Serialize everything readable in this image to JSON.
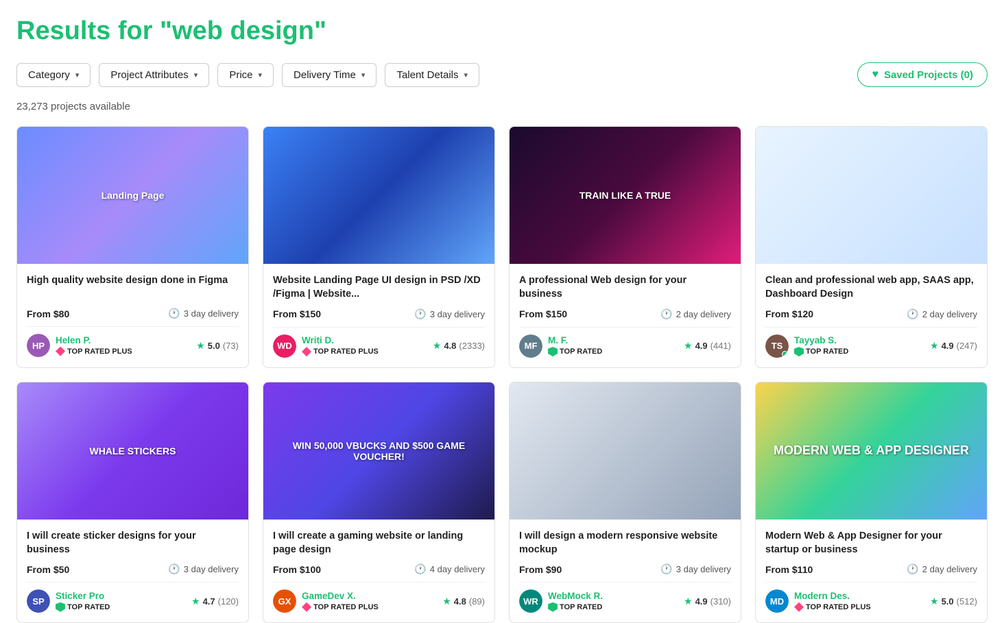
{
  "page": {
    "title": "Results for \"web design\""
  },
  "filters": {
    "category_label": "Category",
    "project_attributes_label": "Project Attributes",
    "price_label": "Price",
    "delivery_time_label": "Delivery Time",
    "talent_details_label": "Talent Details",
    "saved_projects_label": "Saved Projects (0)"
  },
  "results_count": "23,273 projects available",
  "projects": [
    {
      "id": 1,
      "title": "High quality website design done in Figma",
      "from_label": "From",
      "price": "$80",
      "delivery": "3 day delivery",
      "seller_name": "Helen P.",
      "seller_initials": "HP",
      "seller_avatar_color": "#9b59b6",
      "badge_type": "top_rated_plus",
      "badge_label": "TOP RATED PLUS",
      "rating": "5.0",
      "rating_count": "(73)",
      "img_class": "img-landing",
      "img_text": "Landing Page",
      "has_online": false
    },
    {
      "id": 2,
      "title": "Website Landing Page UI design in PSD /XD /Figma | Website...",
      "from_label": "From",
      "price": "$150",
      "delivery": "3 day delivery",
      "seller_name": "Writi D.",
      "seller_initials": "WD",
      "seller_avatar_color": "#e91e63",
      "badge_type": "top_rated_plus",
      "badge_label": "TOP RATED PLUS",
      "rating": "4.8",
      "rating_count": "(2333)",
      "img_class": "img-ui",
      "img_text": "",
      "has_online": false
    },
    {
      "id": 3,
      "title": "A professional Web design for your business",
      "from_label": "From",
      "price": "$150",
      "delivery": "2 day delivery",
      "seller_name": "M. F.",
      "seller_initials": "MF",
      "seller_avatar_color": "#607d8b",
      "badge_type": "top_rated",
      "badge_label": "TOP RATED",
      "rating": "4.9",
      "rating_count": "(441)",
      "img_class": "img-dark",
      "img_text": "TRAIN LIKE A TRUE",
      "has_online": false
    },
    {
      "id": 4,
      "title": "Clean and professional web app, SAAS app, Dashboard Design",
      "from_label": "From",
      "price": "$120",
      "delivery": "2 day delivery",
      "seller_name": "Tayyab S.",
      "seller_initials": "TS",
      "seller_avatar_color": "#795548",
      "badge_type": "top_rated",
      "badge_label": "TOP RATED",
      "rating": "4.9",
      "rating_count": "(247)",
      "img_class": "img-dashboard",
      "img_text": "",
      "has_online": true
    },
    {
      "id": 5,
      "title": "I will create sticker designs for your business",
      "from_label": "From",
      "price": "$50",
      "delivery": "3 day delivery",
      "seller_name": "Sticker Pro",
      "seller_initials": "SP",
      "seller_avatar_color": "#3f51b5",
      "badge_type": "top_rated",
      "badge_label": "TOP RATED",
      "rating": "4.7",
      "rating_count": "(120)",
      "img_class": "img-stickers",
      "img_text": "WHALE STICKERS",
      "has_online": false
    },
    {
      "id": 6,
      "title": "I will create a gaming website or landing page design",
      "from_label": "From",
      "price": "$100",
      "delivery": "4 day delivery",
      "seller_name": "GameDev X.",
      "seller_initials": "GX",
      "seller_avatar_color": "#e65100",
      "badge_type": "top_rated_plus",
      "badge_label": "TOP RATED PLUS",
      "rating": "4.8",
      "rating_count": "(89)",
      "img_class": "img-game",
      "img_text": "WIN 50,000 VBUCKS AND $500 GAME VOUCHER!",
      "has_online": false
    },
    {
      "id": 7,
      "title": "I will design a modern responsive website mockup",
      "from_label": "From",
      "price": "$90",
      "delivery": "3 day delivery",
      "seller_name": "WebMock R.",
      "seller_initials": "WR",
      "seller_avatar_color": "#00897b",
      "badge_type": "top_rated",
      "badge_label": "TOP RATED",
      "rating": "4.9",
      "rating_count": "(310)",
      "img_class": "img-mockup",
      "img_text": "",
      "has_online": false
    },
    {
      "id": 8,
      "title": "Modern Web & App Designer for your startup or business",
      "from_label": "From",
      "price": "$110",
      "delivery": "2 day delivery",
      "seller_name": "Modern Des.",
      "seller_initials": "MD",
      "seller_avatar_color": "#0288d1",
      "badge_type": "top_rated_plus",
      "badge_label": "TOP RATED PLUS",
      "rating": "5.0",
      "rating_count": "(512)",
      "img_class": "img-modern",
      "img_text": "MODERN WEB & APP DESIGNER",
      "has_online": false
    }
  ]
}
